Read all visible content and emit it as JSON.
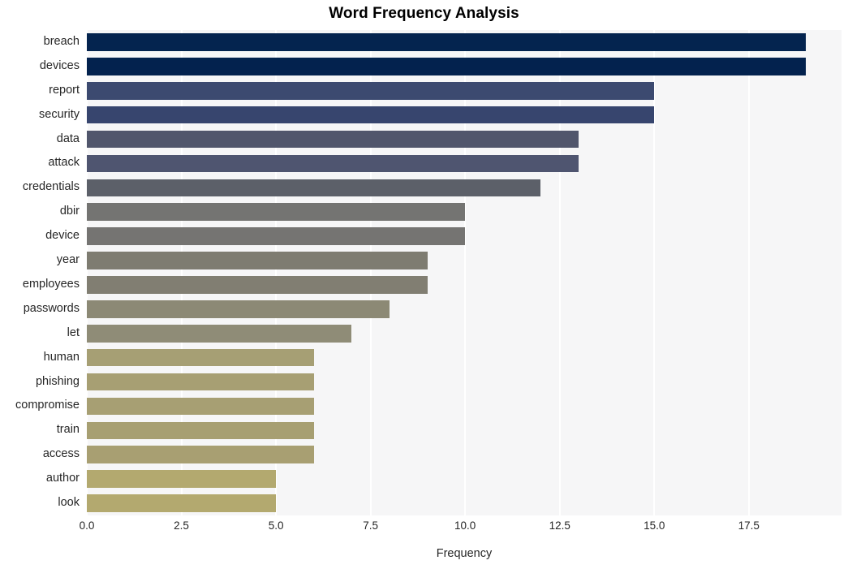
{
  "chart_data": {
    "type": "bar",
    "orientation": "horizontal",
    "title": "Word Frequency Analysis",
    "xlabel": "Frequency",
    "ylabel": "",
    "xlim": [
      0,
      19.95
    ],
    "xticks": [
      0.0,
      2.5,
      5.0,
      7.5,
      10.0,
      12.5,
      15.0,
      17.5
    ],
    "xticklabels": [
      "0.0",
      "2.5",
      "5.0",
      "7.5",
      "10.0",
      "12.5",
      "15.0",
      "17.5"
    ],
    "grid": true,
    "grid_axis": "x",
    "grid_color": "#ffffff",
    "legend": false,
    "plot_background": "#f6f6f7",
    "figure_background": "#ffffff",
    "categories": [
      "breach",
      "devices",
      "report",
      "security",
      "data",
      "attack",
      "credentials",
      "dbir",
      "device",
      "year",
      "employees",
      "passwords",
      "let",
      "human",
      "phishing",
      "compromise",
      "train",
      "access",
      "author",
      "look"
    ],
    "values": [
      19,
      19,
      15,
      15,
      13,
      13,
      12,
      10,
      10,
      9,
      9,
      8,
      7,
      6,
      6,
      6,
      6,
      6,
      5,
      5
    ],
    "bar_colors": [
      "#04244f",
      "#03224e",
      "#3c4a70",
      "#37456e",
      "#51566c",
      "#4f5570",
      "#5c6069",
      "#747472",
      "#757472",
      "#7e7c71",
      "#817e72",
      "#8c8975",
      "#8f8c77",
      "#a69f74",
      "#a79f73",
      "#a79f73",
      "#a79f72",
      "#a89f72",
      "#b3a96f",
      "#b3a96f"
    ]
  }
}
